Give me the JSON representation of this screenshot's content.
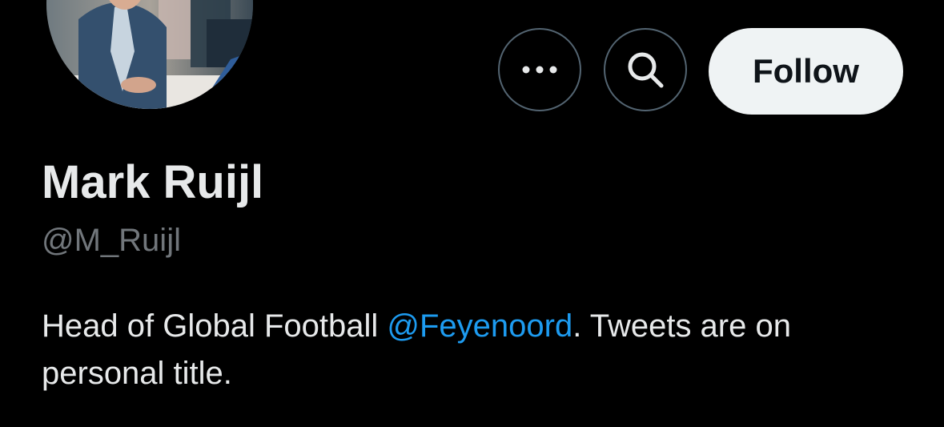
{
  "profile": {
    "display_name": "Mark Ruijl",
    "handle": "@M_Ruijl",
    "bio": {
      "prefix": "Head of Global Football ",
      "mention": "@Feyenoord",
      "suffix": ". Tweets are on personal title."
    }
  },
  "actions": {
    "more_icon": "more-horizontal-icon",
    "search_icon": "search-icon",
    "follow_label": "Follow"
  },
  "colors": {
    "background": "#000000",
    "primary_text": "#e7e9ea",
    "secondary_text": "#71767b",
    "link": "#1d9bf0",
    "button_border": "#536471",
    "follow_bg": "#eff3f4",
    "follow_text": "#0f1419"
  }
}
